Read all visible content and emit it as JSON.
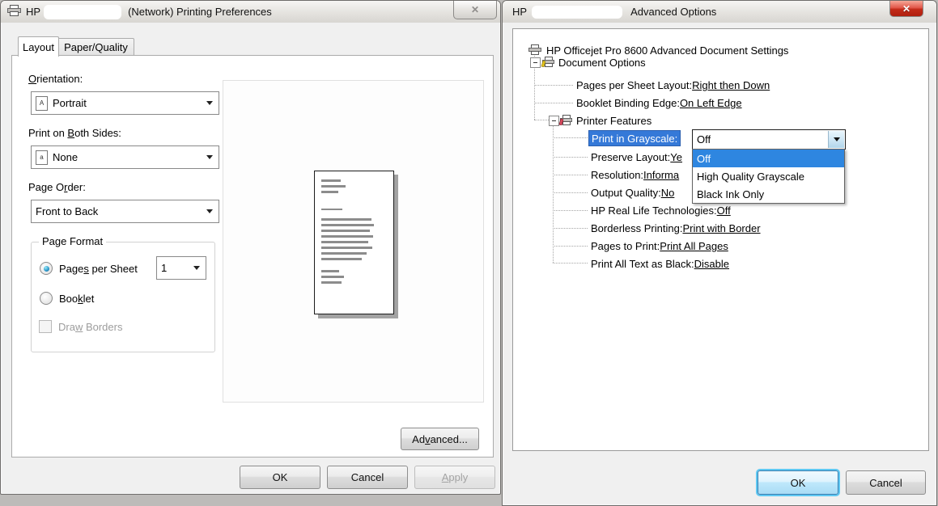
{
  "left_dialog": {
    "titlebar": {
      "app_prefix": "HP",
      "title_suffix": "(Network) Printing Preferences",
      "close_label": "✕"
    },
    "tabs": {
      "layout": "Layout",
      "paper_quality": "Paper/Quality"
    },
    "fields": {
      "orientation": {
        "label": {
          "pre": "",
          "key": "O",
          "post": "rientation:"
        },
        "value": "Portrait",
        "icon_letter": "A"
      },
      "both_sides": {
        "label": {
          "pre": "Print on ",
          "key": "B",
          "post": "oth Sides:"
        },
        "value": "None",
        "icon_letter": "a"
      },
      "page_order": {
        "label": {
          "pre": "Page O",
          "key": "r",
          "post": "der:"
        },
        "value": "Front to Back"
      }
    },
    "page_format": {
      "title": "Page Format",
      "pages_per_sheet": {
        "pre": "Page",
        "key": "s",
        "post": " per Sheet"
      },
      "pages_per_sheet_value": "1",
      "booklet": {
        "pre": "Boo",
        "key": "k",
        "post": "let"
      },
      "draw_borders": {
        "pre": "Dra",
        "key": "w",
        "post": " Borders"
      }
    },
    "advanced_button": {
      "pre": "Ad",
      "key": "v",
      "post": "anced..."
    },
    "footer": {
      "ok": "OK",
      "cancel": "Cancel",
      "apply": {
        "pre": "",
        "key": "A",
        "post": "pply"
      }
    }
  },
  "right_dialog": {
    "titlebar": {
      "app_prefix": "HP",
      "title_suffix": "Advanced Options",
      "close_label": "✕"
    },
    "tree": {
      "root": "HP Officejet Pro 8600 Advanced Document Settings",
      "document_options": "Document Options",
      "doc_items": [
        {
          "name": "Pages per Sheet Layout: ",
          "value": "Right then Down"
        },
        {
          "name": "Booklet Binding Edge: ",
          "value": "On Left Edge"
        }
      ],
      "printer_features": "Printer Features",
      "selected_feature": "Print in Grayscale:",
      "feature_items": [
        {
          "name": "Preserve Layout: ",
          "value": "Ye"
        },
        {
          "name": "Resolution: ",
          "value": "Informa"
        },
        {
          "name": "Output Quality: ",
          "value": "No"
        },
        {
          "name": "HP Real Life Technologies: ",
          "value": "Off"
        },
        {
          "name": "Borderless Printing: ",
          "value": "Print with Border"
        },
        {
          "name": "Pages to Print: ",
          "value": "Print All Pages"
        },
        {
          "name": "Print All Text as Black: ",
          "value": "Disable"
        }
      ]
    },
    "grayscale_combo": {
      "value": "Off"
    },
    "dropdown": {
      "options": [
        "Off",
        "High Quality Grayscale",
        "Black Ink Only"
      ],
      "selected": "Off"
    },
    "footer": {
      "ok": "OK",
      "cancel": "Cancel"
    }
  },
  "colors": {
    "tree_selection": "#3579d8",
    "list_selection": "#2e86e0",
    "close_button_red": "#c22c1a",
    "default_button_glow": "#5fc8f2"
  }
}
